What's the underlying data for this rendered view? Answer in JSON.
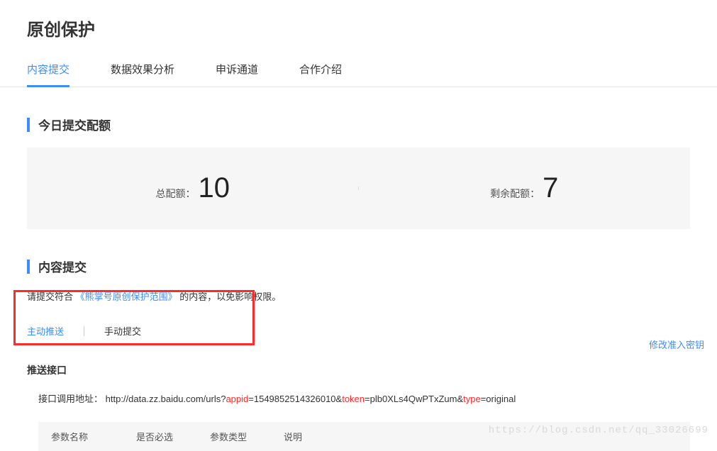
{
  "page_title": "原创保护",
  "tabs": [
    {
      "label": "内容提交",
      "active": true
    },
    {
      "label": "数据效果分析",
      "active": false
    },
    {
      "label": "申诉通道",
      "active": false
    },
    {
      "label": "合作介绍",
      "active": false
    }
  ],
  "section_quota_title": "今日提交配额",
  "quota": {
    "total_label": "总配额：",
    "total_value": "10",
    "remain_label": "剩余配额：",
    "remain_value": "7"
  },
  "section_submit_title": "内容提交",
  "submit_desc_prefix": "请提交符合",
  "submit_desc_link": "《熊掌号原创保护范围》",
  "submit_desc_suffix": "的内容，以免影响权限。",
  "submit_modes": [
    {
      "label": "主动推送",
      "active": true
    },
    {
      "label": "手动提交",
      "active": false
    }
  ],
  "modify_key_link": "修改准入密钥",
  "push_api_title": "推送接口",
  "api_url": {
    "label": "接口调用地址：",
    "prefix": "http://data.zz.baidu.com/urls?",
    "key1": "appid",
    "val1": "=1549852514326010&",
    "key2": "token",
    "val2": "=plb0XLs4QwPTxZum&",
    "key3": "type",
    "val3": "=original"
  },
  "param_table_headers": [
    "参数名称",
    "是否必选",
    "参数类型",
    "说明"
  ],
  "watermark": "https://blog.csdn.net/qq_33026699"
}
